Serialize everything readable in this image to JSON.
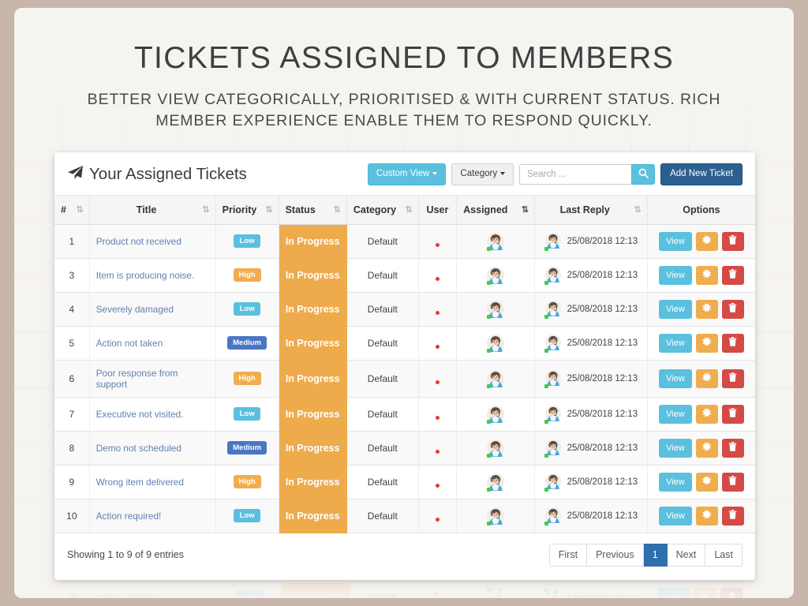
{
  "slide": {
    "title": "Tickets Assigned To Members",
    "subtitle": "Better view categorically, prioritised & with current status. Rich member experience enable them to respond quickly."
  },
  "card": {
    "title": "Your Assigned Tickets",
    "title_icon": "paper-plane-icon"
  },
  "toolbar": {
    "custom_view_label": "Custom View",
    "category_label": "Category",
    "search_placeholder": "Search ...",
    "search_value": "",
    "search_icon": "search-icon",
    "add_ticket_label": "Add New Ticket"
  },
  "table": {
    "columns": [
      {
        "label": "#",
        "sort": "both",
        "key": "id"
      },
      {
        "label": "Title",
        "sort": "both",
        "key": "title"
      },
      {
        "label": "Priority",
        "sort": "both",
        "key": "priority"
      },
      {
        "label": "Status",
        "sort": "both",
        "key": "status"
      },
      {
        "label": "Category",
        "sort": "both",
        "key": "category"
      },
      {
        "label": "User",
        "sort": "none",
        "key": "user"
      },
      {
        "label": "Assigned",
        "sort": "active",
        "key": "assigned"
      },
      {
        "label": "Last Reply",
        "sort": "both",
        "key": "last_reply"
      },
      {
        "label": "Options",
        "sort": "none",
        "key": "options"
      }
    ],
    "rows": [
      {
        "id": "1",
        "title": "Product not received",
        "priority": "Low",
        "status": "In Progress",
        "category": "Default",
        "last_reply": "25/08/2018 12:13"
      },
      {
        "id": "3",
        "title": "Item is producing noise.",
        "priority": "High",
        "status": "In Progress",
        "category": "Default",
        "last_reply": "25/08/2018 12:13"
      },
      {
        "id": "4",
        "title": "Severely damaged",
        "priority": "Low",
        "status": "In Progress",
        "category": "Default",
        "last_reply": "25/08/2018 12:13"
      },
      {
        "id": "5",
        "title": "Action not taken",
        "priority": "Medium",
        "status": "In Progress",
        "category": "Default",
        "last_reply": "25/08/2018 12:13"
      },
      {
        "id": "6",
        "title": "Poor response from support",
        "priority": "High",
        "status": "In Progress",
        "category": "Default",
        "last_reply": "25/08/2018 12:13"
      },
      {
        "id": "7",
        "title": "Executive not visited.",
        "priority": "Low",
        "status": "In Progress",
        "category": "Default",
        "last_reply": "25/08/2018 12:13"
      },
      {
        "id": "8",
        "title": "Demo not scheduled",
        "priority": "Medium",
        "status": "In Progress",
        "category": "Default",
        "last_reply": "25/08/2018 12:13"
      },
      {
        "id": "9",
        "title": "Wrong item delivered",
        "priority": "High",
        "status": "In Progress",
        "category": "Default",
        "last_reply": "25/08/2018 12:13"
      },
      {
        "id": "10",
        "title": "Action required!",
        "priority": "Low",
        "status": "In Progress",
        "category": "Default",
        "last_reply": "25/08/2018 12:13"
      }
    ],
    "row_actions": {
      "view_label": "View",
      "settings_icon": "gear-icon",
      "delete_icon": "trash-icon"
    },
    "user_icon": "red-status-dot-icon",
    "assigned_avatar_icon": "agent-avatar-icon",
    "online_badge_icon": "online-status-icon"
  },
  "footer": {
    "entries_info": "Showing 1 to 9 of 9 entries",
    "pagination": [
      {
        "label": "First",
        "active": false
      },
      {
        "label": "Previous",
        "active": false
      },
      {
        "label": "1",
        "active": true
      },
      {
        "label": "Next",
        "active": false
      },
      {
        "label": "Last",
        "active": false
      }
    ]
  },
  "colors": {
    "slide_background": "#c8b6aa",
    "panel_background": "#f6f4f1",
    "badge_low": "#5bc0de",
    "badge_high": "#f0ad4e",
    "badge_medium": "#4a76c4",
    "status_cell": "#eeab4c",
    "view_button": "#5bc0de",
    "settings_button": "#f0ad4e",
    "delete_button": "#d44a46",
    "add_ticket_button": "#2b5f8e",
    "pagination_active": "#2f6fad",
    "ticket_link": "#5f82ae",
    "user_dot": "#e23b2e",
    "online_dot": "#44cc44"
  }
}
